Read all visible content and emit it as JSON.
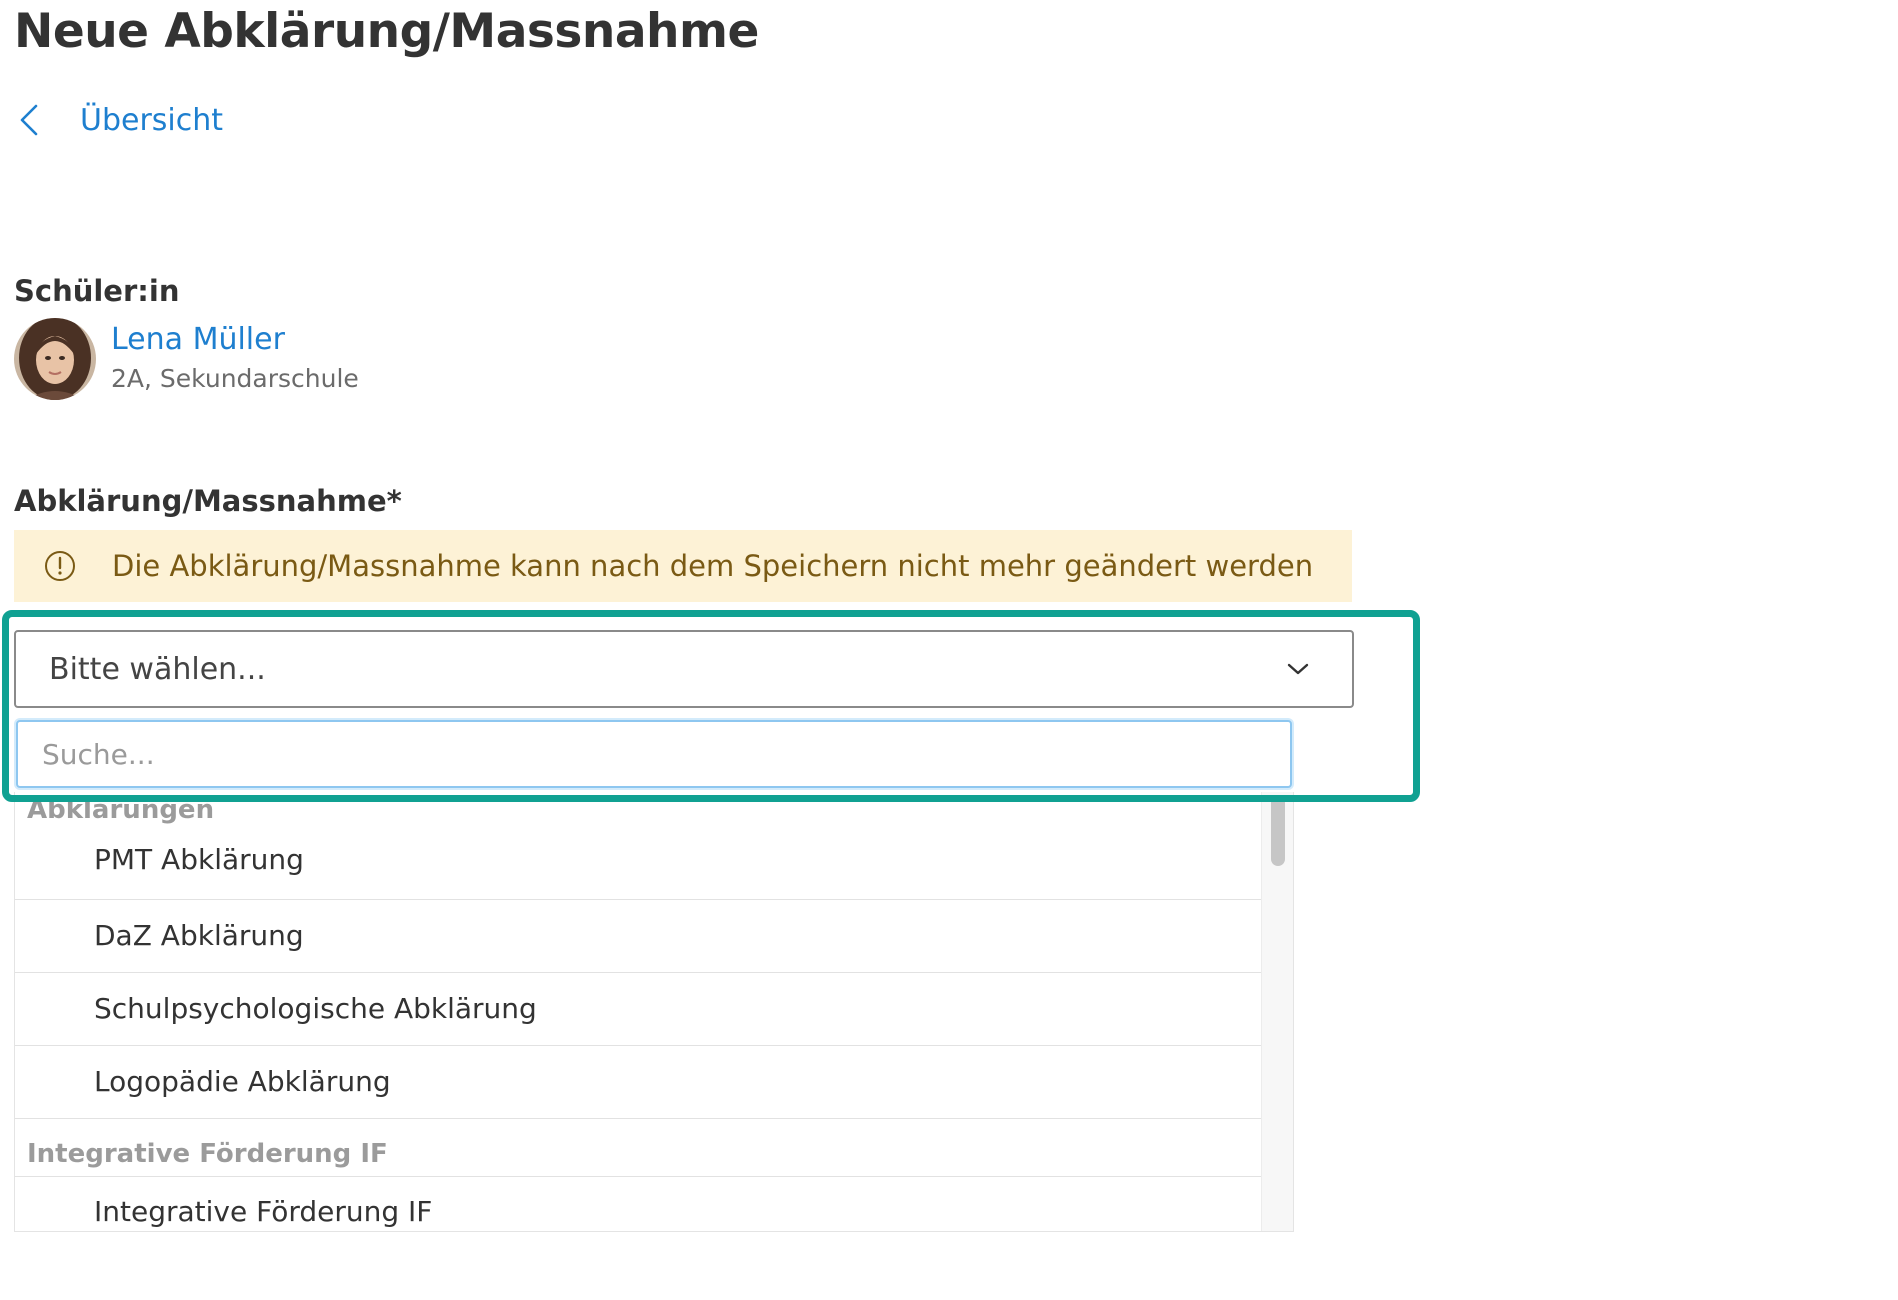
{
  "page": {
    "title": "Neue Abklärung/Massnahme"
  },
  "nav": {
    "back_label": "Übersicht",
    "back_icon": "chevron-left-icon"
  },
  "student": {
    "label": "Schüler:in",
    "name": "Lena Müller",
    "class_info": "2A, Sekundarschule"
  },
  "form": {
    "field_label": "Abklärung/Massnahme*",
    "warning": "Die Abklärung/Massnahme kann nach dem Speichern nicht mehr geändert werden",
    "warning_icon": "info-circle-icon",
    "select_value": "Bitte wählen...",
    "search_placeholder": "Suche...",
    "search_value": ""
  },
  "dropdown": {
    "groups": [
      {
        "header": "Abklärungen",
        "options": [
          "PMT Abklärung",
          "DaZ Abklärung",
          "Schulpsychologische Abklärung",
          "Logopädie Abklärung"
        ]
      },
      {
        "header": "Integrative Förderung IF",
        "options": [
          "Integrative Förderung IF"
        ]
      }
    ]
  },
  "colors": {
    "accent_link": "#1e7fcf",
    "warning_bg": "#fdf2d6",
    "warning_text": "#7a5a14",
    "highlight": "#10a192",
    "focus_border": "#8ec7f0"
  }
}
